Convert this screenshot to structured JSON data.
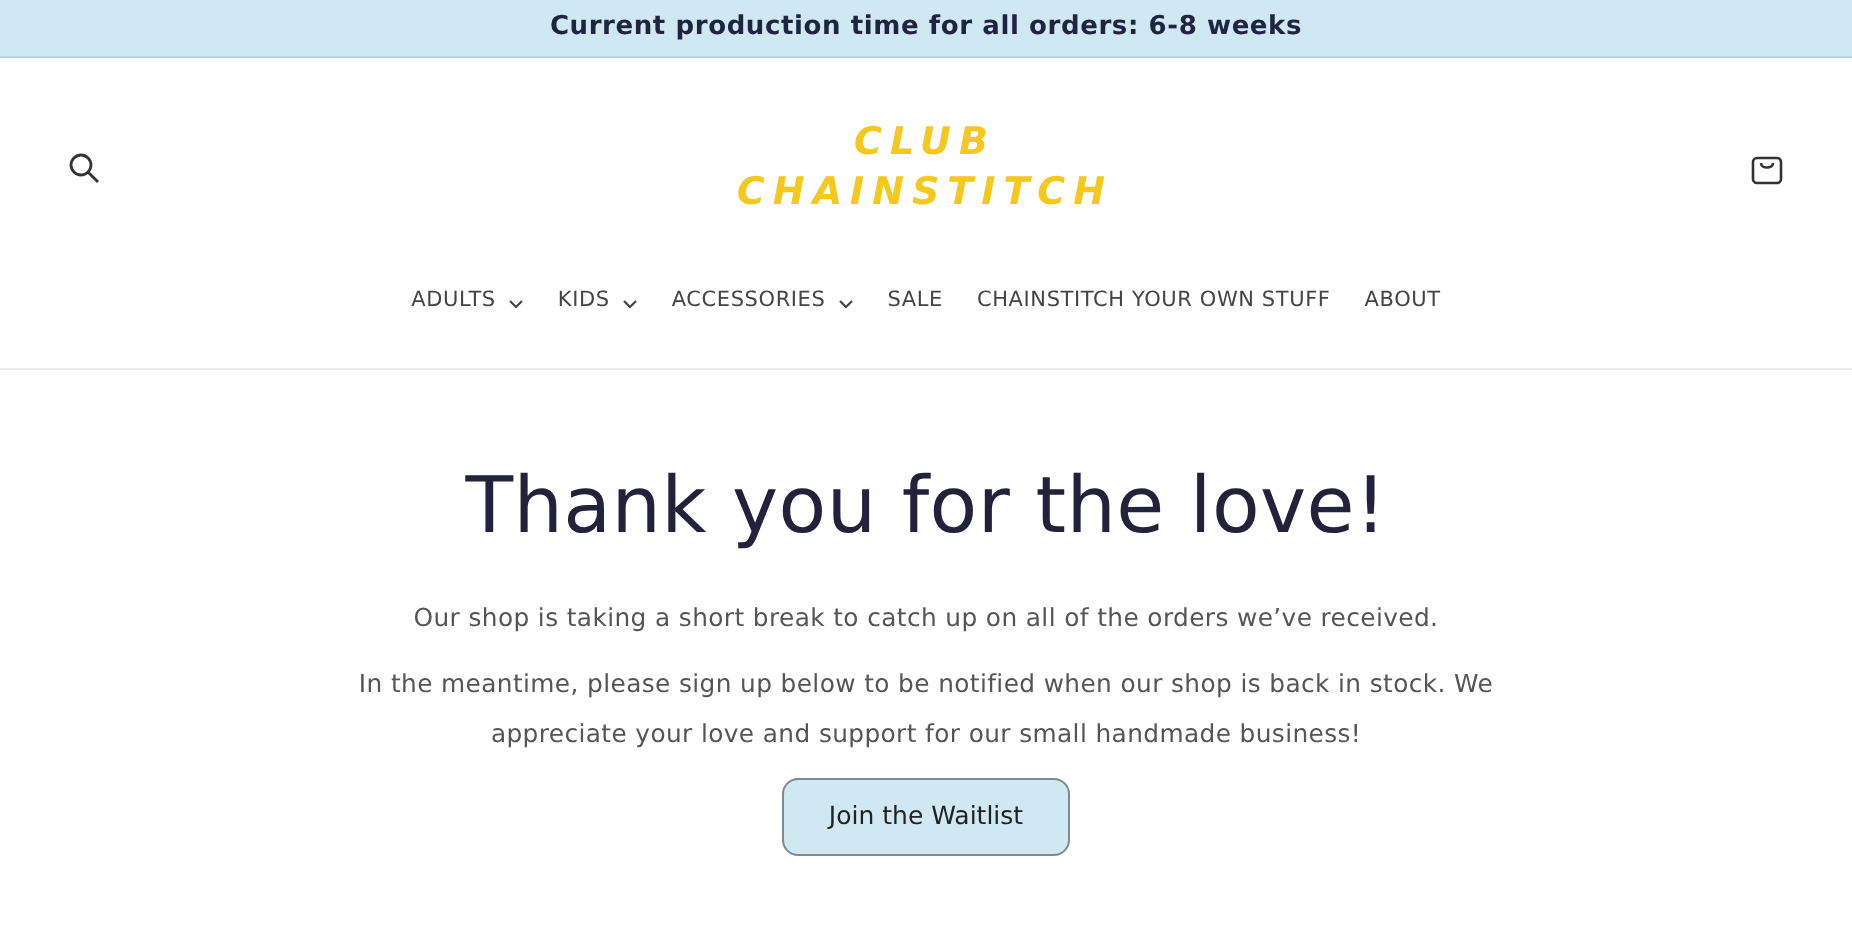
{
  "announcement": "Current production time for all orders: 6-8 weeks",
  "logo": {
    "lines": [
      "CLUB",
      "CHAINSTITCH"
    ]
  },
  "nav": [
    {
      "label": "ADULTS",
      "dropdown": true
    },
    {
      "label": "KIDS",
      "dropdown": true
    },
    {
      "label": "ACCESSORIES",
      "dropdown": true
    },
    {
      "label": "SALE",
      "dropdown": false
    },
    {
      "label": "CHAINSTITCH YOUR OWN STUFF",
      "dropdown": false
    },
    {
      "label": "ABOUT",
      "dropdown": false
    }
  ],
  "heading": "Thank you for the love!",
  "paragraphs": [
    "Our shop is taking a short break to catch up on all of the orders we’ve received.",
    "In the meantime, please sign up below to be notified when our shop is back in stock. We appreciate your love and support for our small handmade business!"
  ],
  "button": "Join the Waitlist"
}
